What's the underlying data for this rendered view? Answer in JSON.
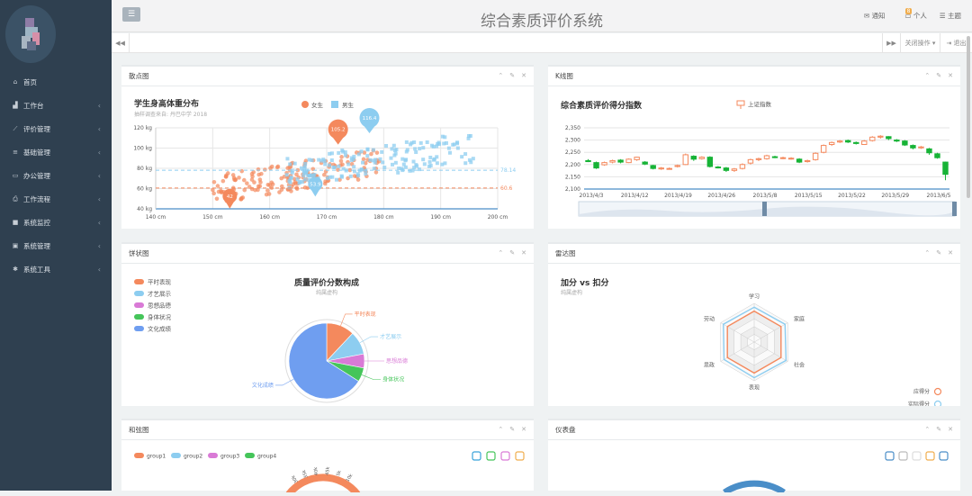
{
  "app": {
    "title": "综合素质评价系统"
  },
  "topnav": {
    "notice": "通知",
    "notice_badge": "8",
    "personal": "个人",
    "theme": "主题"
  },
  "tabbar": {
    "close_ops": "关闭操作",
    "logout": "退出"
  },
  "sidebar": {
    "items": [
      {
        "label": "首页",
        "icon": "home-icon",
        "chevron": false
      },
      {
        "label": "工作台",
        "icon": "chart-icon",
        "chevron": true
      },
      {
        "label": "评价管理",
        "icon": "line-chart-icon",
        "chevron": true
      },
      {
        "label": "基础管理",
        "icon": "list-icon",
        "chevron": true
      },
      {
        "label": "办公管理",
        "icon": "laptop-icon",
        "chevron": true
      },
      {
        "label": "工作流程",
        "icon": "print-icon",
        "chevron": true
      },
      {
        "label": "系统监控",
        "icon": "video-icon",
        "chevron": true
      },
      {
        "label": "系统管理",
        "icon": "desktop-icon",
        "chevron": true
      },
      {
        "label": "系统工具",
        "icon": "gear-icon",
        "chevron": true
      }
    ]
  },
  "panels": {
    "scatter": "散点图",
    "kline": "K线图",
    "pie": "饼状图",
    "radar": "雷达图",
    "chord": "和弦图",
    "gauge": "仪表盘"
  },
  "chart_data": [
    {
      "type": "scatter",
      "title": "学生身高体重分布",
      "subtitle": "抽样调查来自: 丹巴中学 2018",
      "legend": [
        "女生",
        "男生"
      ],
      "colors": {
        "female": "#f4895d",
        "male": "#8dcdf0"
      },
      "xlim": [
        140,
        200
      ],
      "ylim": [
        40,
        120
      ],
      "xticks": [
        "140 cm",
        "150 cm",
        "160 cm",
        "170 cm",
        "180 cm",
        "190 cm",
        "200 cm"
      ],
      "yticks": [
        "40 kg",
        "60 kg",
        "80 kg",
        "100 kg",
        "120 kg"
      ],
      "markpoints": [
        {
          "series": "女生",
          "label": "105.2",
          "x": 172,
          "y": 105.2
        },
        {
          "series": "女生",
          "label": "42",
          "x": 153,
          "y": 42
        },
        {
          "series": "男生",
          "label": "116.4",
          "x": 177.5,
          "y": 116.4
        },
        {
          "series": "男生",
          "label": "53.9",
          "x": 168,
          "y": 53.9
        }
      ],
      "marklines": [
        {
          "series": "女生",
          "label": "60.6",
          "y": 60.6
        },
        {
          "series": "男生",
          "label": "78.14",
          "y": 78.14
        }
      ]
    },
    {
      "type": "candlestick",
      "title": "综合素质评价得分指数",
      "legend": "上证指数",
      "xticks": [
        "2013/4/3",
        "2013/4/12",
        "2013/4/19",
        "2013/4/26",
        "2013/5/8",
        "2013/5/15",
        "2013/5/22",
        "2013/5/29",
        "2013/6/5"
      ],
      "yticks": [
        "2,100",
        "2,150",
        "2,200",
        "2,250",
        "2,300",
        "2,350"
      ],
      "ylim": [
        2100,
        2350
      ],
      "candles": [
        [
          2216,
          2212,
          2210,
          2222
        ],
        [
          2208,
          2186,
          2182,
          2212
        ],
        [
          2199,
          2208,
          2195,
          2212
        ],
        [
          2210,
          2216,
          2205,
          2220
        ],
        [
          2218,
          2210,
          2205,
          2222
        ],
        [
          2208,
          2222,
          2206,
          2225
        ],
        [
          2220,
          2230,
          2215,
          2232
        ],
        [
          2210,
          2202,
          2198,
          2214
        ],
        [
          2196,
          2184,
          2180,
          2199
        ],
        [
          2182,
          2186,
          2178,
          2190
        ],
        [
          2184,
          2184,
          2180,
          2188
        ],
        [
          2192,
          2196,
          2188,
          2200
        ],
        [
          2200,
          2240,
          2198,
          2245
        ],
        [
          2234,
          2222,
          2215,
          2238
        ],
        [
          2224,
          2230,
          2220,
          2234
        ],
        [
          2230,
          2192,
          2188,
          2234
        ],
        [
          2190,
          2188,
          2184,
          2194
        ],
        [
          2186,
          2176,
          2170,
          2190
        ],
        [
          2176,
          2182,
          2170,
          2186
        ],
        [
          2184,
          2200,
          2180,
          2205
        ],
        [
          2206,
          2220,
          2200,
          2224
        ],
        [
          2220,
          2224,
          2214,
          2228
        ],
        [
          2224,
          2236,
          2220,
          2240
        ],
        [
          2232,
          2230,
          2226,
          2236
        ],
        [
          2228,
          2228,
          2222,
          2232
        ],
        [
          2226,
          2226,
          2220,
          2230
        ],
        [
          2222,
          2210,
          2206,
          2226
        ],
        [
          2212,
          2216,
          2208,
          2220
        ],
        [
          2220,
          2246,
          2216,
          2250
        ],
        [
          2250,
          2278,
          2246,
          2282
        ],
        [
          2282,
          2290,
          2276,
          2294
        ],
        [
          2292,
          2296,
          2288,
          2300
        ],
        [
          2298,
          2292,
          2288,
          2302
        ],
        [
          2290,
          2286,
          2282,
          2294
        ],
        [
          2282,
          2296,
          2280,
          2300
        ],
        [
          2298,
          2312,
          2294,
          2316
        ],
        [
          2312,
          2316,
          2306,
          2320
        ],
        [
          2314,
          2306,
          2300,
          2316
        ],
        [
          2300,
          2296,
          2292,
          2304
        ],
        [
          2296,
          2280,
          2276,
          2300
        ],
        [
          2278,
          2268,
          2262,
          2282
        ],
        [
          2268,
          2272,
          2264,
          2276
        ],
        [
          2264,
          2248,
          2240,
          2268
        ],
        [
          2244,
          2228,
          2224,
          2248
        ],
        [
          2210,
          2160,
          2136,
          2212
        ]
      ]
    },
    {
      "type": "pie",
      "title": "质量评价分数构成",
      "subtitle": "纯属虚构",
      "slices": [
        {
          "name": "平时表现",
          "value": 12,
          "color": "#f4895d"
        },
        {
          "name": "才艺展示",
          "value": 10,
          "color": "#8dcdf0"
        },
        {
          "name": "思想品德",
          "value": 6,
          "color": "#d97ad6"
        },
        {
          "name": "身体状况",
          "value": 6,
          "color": "#45c55a"
        },
        {
          "name": "文化成绩",
          "value": 66,
          "color": "#6f9ef0"
        }
      ]
    },
    {
      "type": "radar",
      "title": "加分 vs 扣分",
      "subtitle": "纯属虚构",
      "indicators": [
        "学习",
        "家庭",
        "社会",
        "表现",
        "思政",
        "劳动"
      ],
      "series": [
        {
          "name": "应得分",
          "color": "#f4895d",
          "values": [
            0.8,
            0.8,
            0.8,
            0.8,
            0.8,
            0.8
          ]
        },
        {
          "name": "实际得分",
          "color": "#8dcdf0",
          "values": [
            0.9,
            0.92,
            0.95,
            0.92,
            0.9,
            0.92
          ]
        }
      ]
    },
    {
      "type": "chord",
      "legend": [
        "group1",
        "group2",
        "group3",
        "group4"
      ],
      "colors": [
        "#f4895d",
        "#8dcdf0",
        "#d97ad6",
        "#45c55a"
      ],
      "ticks": [
        "30k",
        "35k",
        "40k",
        "45k",
        "5k",
        "10k"
      ]
    }
  ]
}
